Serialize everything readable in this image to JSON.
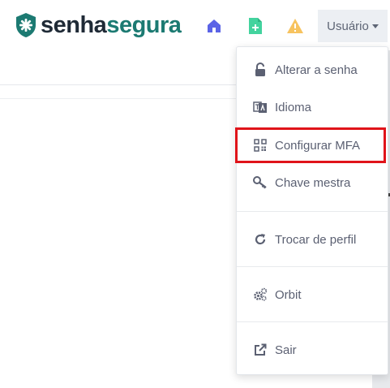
{
  "header": {
    "logo": {
      "part1": "senha",
      "part2": "segura"
    },
    "icons": [
      "home-icon",
      "new-document-icon",
      "warning-icon"
    ],
    "user_menu_label": "Usuário"
  },
  "dropdown": {
    "items": [
      {
        "label": "Alterar a senha",
        "icon": "unlock-icon"
      },
      {
        "label": "Idioma",
        "icon": "language-icon"
      },
      {
        "label": "Configurar MFA",
        "icon": "qr-code-icon"
      },
      {
        "label": "Chave mestra",
        "icon": "key-icon"
      },
      {
        "label": "Trocar de perfil",
        "icon": "refresh-icon"
      },
      {
        "label": "Orbit",
        "icon": "gears-icon"
      },
      {
        "label": "Sair",
        "icon": "external-link-icon"
      }
    ],
    "highlighted_item": "Configurar MFA"
  },
  "colors": {
    "logo_dark": "#1f2a36",
    "logo_teal": "#1c7a72",
    "home_blue": "#5b63e6",
    "newdoc_green": "#43d39e",
    "warning_yellow": "#f7c35f",
    "highlight_red": "#e0141a"
  }
}
